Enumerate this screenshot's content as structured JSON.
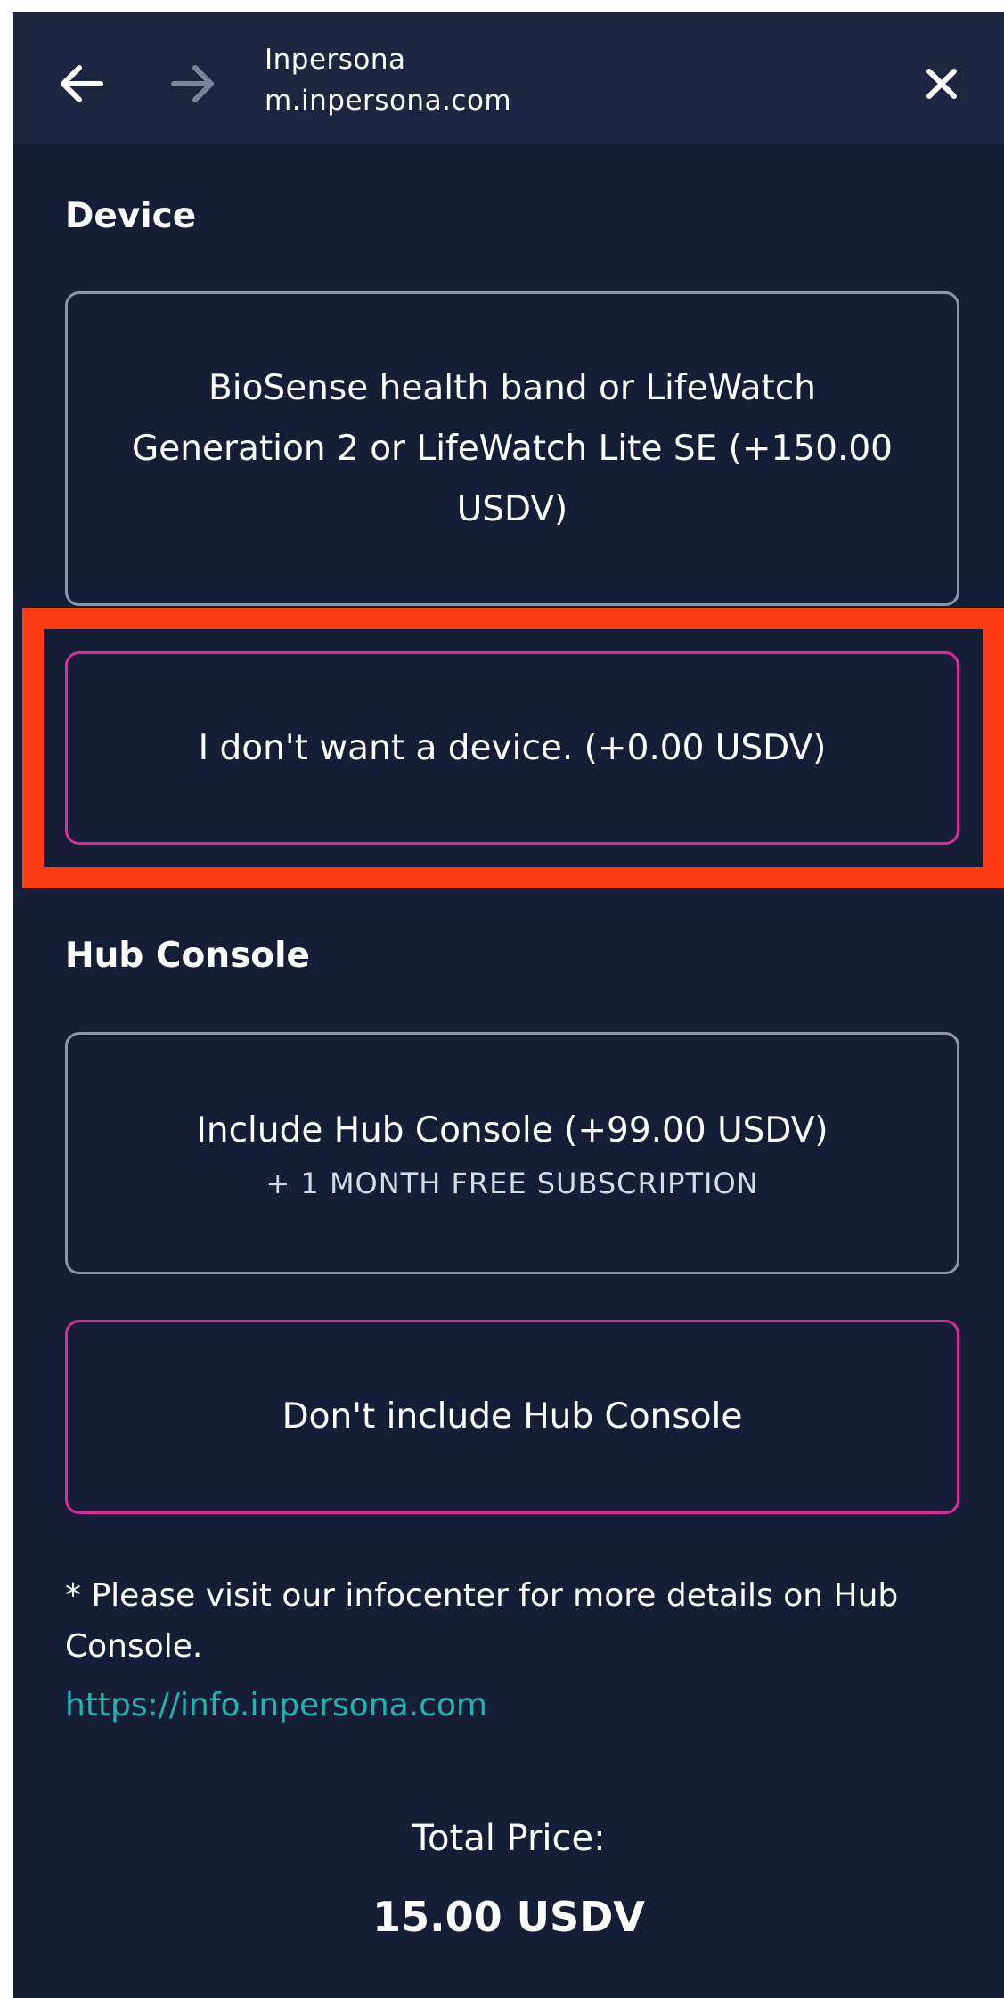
{
  "browser": {
    "site_name": "Inpersona",
    "url": "m.inpersona.com",
    "icons": {
      "back": "back-arrow-icon",
      "forward": "forward-arrow-icon",
      "close": "close-icon"
    }
  },
  "device_section": {
    "label": "Device",
    "options": [
      {
        "label": "BioSense health band or LifeWatch Generation 2 or LifeWatch Lite SE (+150.00 USDV)",
        "selected": false
      },
      {
        "label": "I don't want a device. (+0.00 USDV)",
        "selected": true
      }
    ]
  },
  "hub_section": {
    "label": "Hub Console",
    "options": [
      {
        "label": "Include Hub Console (+99.00 USDV)",
        "sublabel": "+ 1 MONTH FREE SUBSCRIPTION",
        "selected": false
      },
      {
        "label": "Don't include Hub Console",
        "selected": true
      }
    ]
  },
  "note": {
    "text": "* Please visit our infocenter for more details on Hub Console.",
    "link": "https://info.inpersona.com"
  },
  "total": {
    "label": "Total Price:",
    "value": "15.00 USDV"
  },
  "colors": {
    "background": "#161d36",
    "topbar": "#1d2540",
    "selected_border": "#d62c9e",
    "unselected_border": "#8d94ad",
    "link": "#1eb4b2",
    "highlight": "#ff3d14"
  }
}
